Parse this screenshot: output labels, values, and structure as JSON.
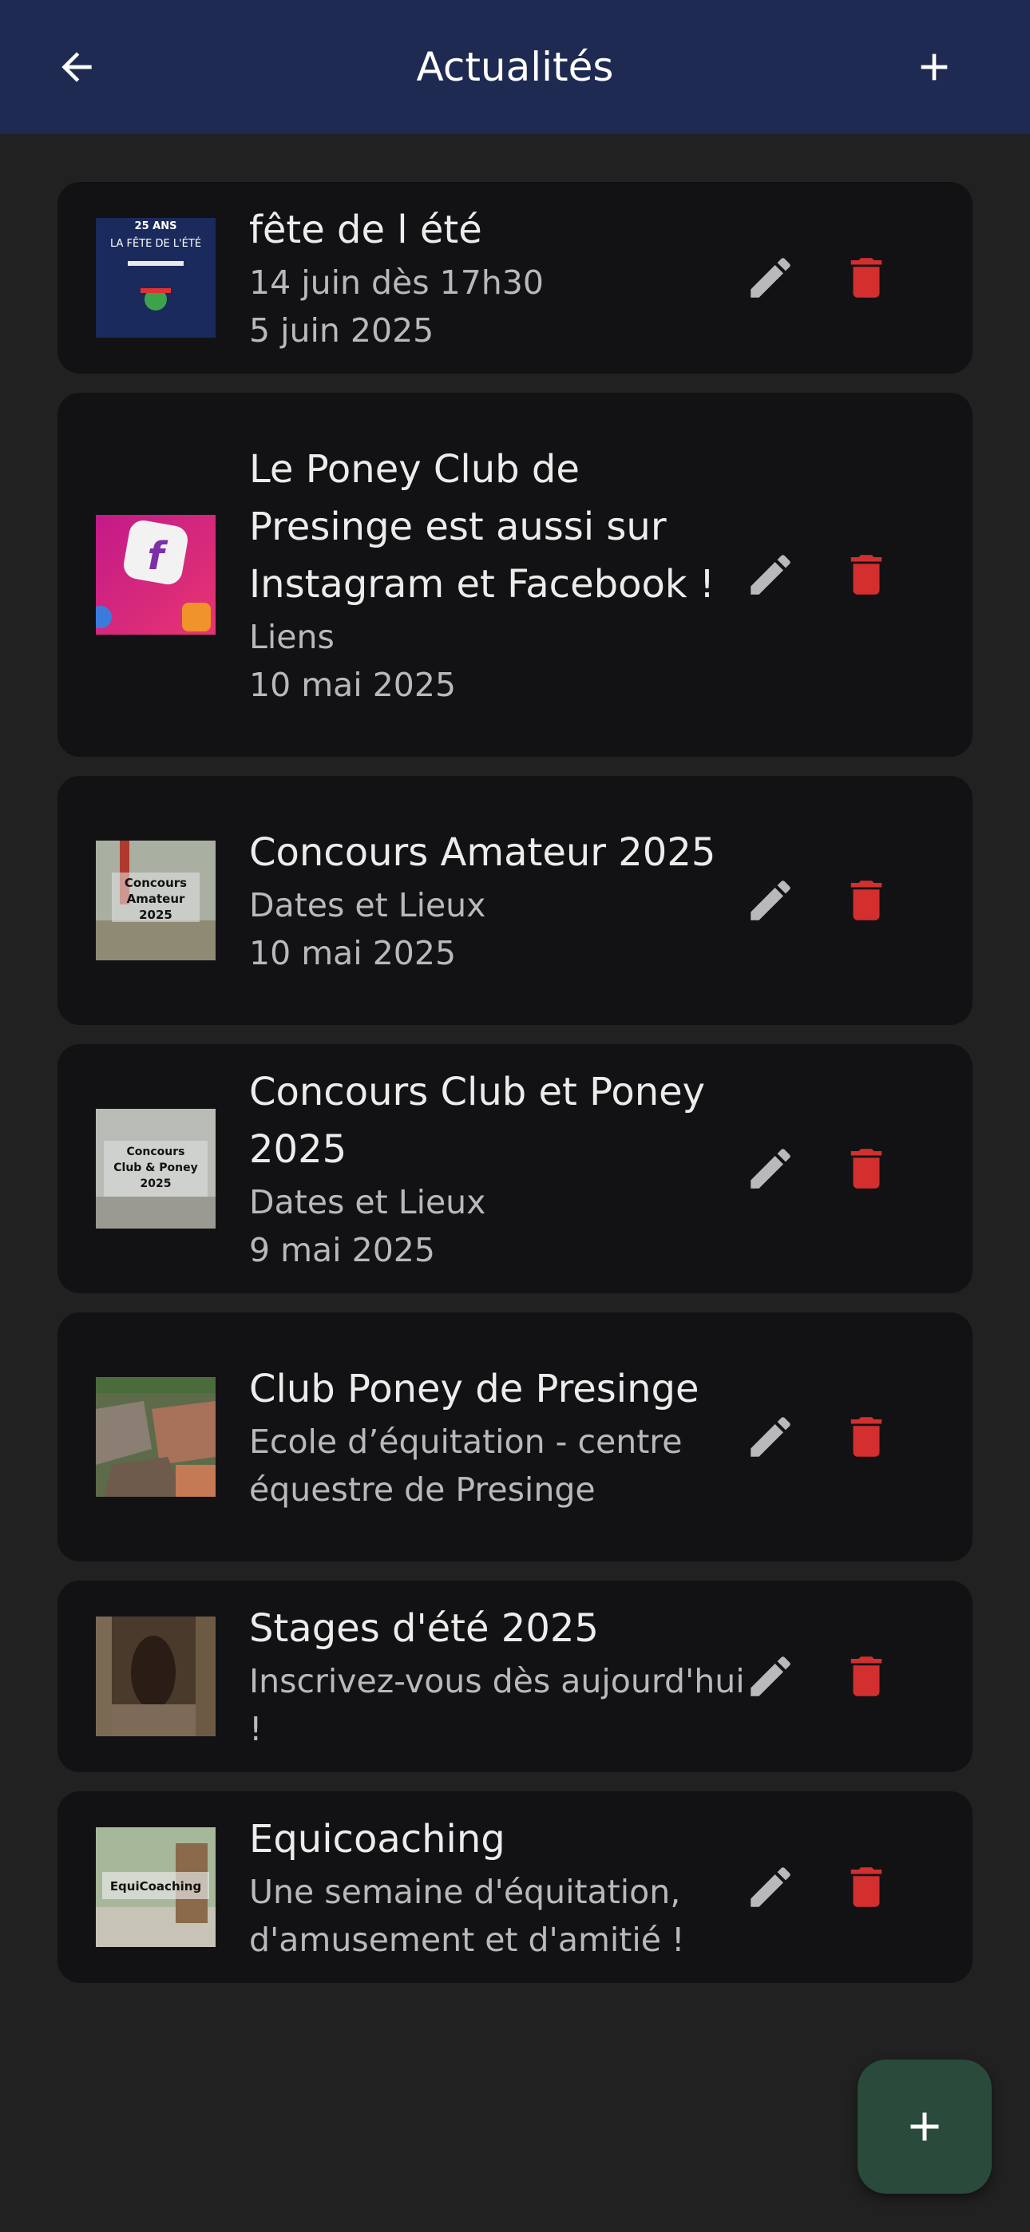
{
  "header": {
    "title": "Actualités",
    "back_icon": "arrow-back-icon",
    "add_icon": "plus-icon"
  },
  "colors": {
    "appbar": "#1e2a52",
    "background": "#212121",
    "card": "#121214",
    "edit": "#b9b9bc",
    "delete": "#d32f2f",
    "fab": "#2a4a3b"
  },
  "items": [
    {
      "title": "fête de l été",
      "lines": [
        "14 juin dès 17h30",
        "5 juin 2025"
      ],
      "thumb_text": [
        "25 ANS",
        "LA FÊTE DE L'ÉTÉ"
      ]
    },
    {
      "title": "Le Poney Club de Presinge est aussi sur Instagram et Facebook !",
      "lines": [
        "Liens",
        "10 mai 2025"
      ],
      "thumb_text": [
        "f"
      ]
    },
    {
      "title": "Concours Amateur 2025",
      "lines": [
        "Dates et Lieux",
        "10 mai 2025"
      ],
      "thumb_text": [
        "Concours",
        "Amateur",
        "2025"
      ]
    },
    {
      "title": "Concours Club et Poney 2025",
      "lines": [
        "Dates et Lieux",
        "9 mai 2025"
      ],
      "thumb_text": [
        "Concours",
        "Club & Poney",
        "2025"
      ]
    },
    {
      "title": "Club Poney de Presinge",
      "lines": [
        "Ecole d’équitation - centre équestre de Presinge"
      ],
      "thumb_text": []
    },
    {
      "title": "Stages d'été 2025",
      "lines": [
        "Inscrivez-vous dès aujourd'hui !"
      ],
      "thumb_text": []
    },
    {
      "title": "Equicoaching",
      "lines": [
        "Une semaine d'équitation, d'amusement et d'amitié !"
      ],
      "thumb_text": [
        "EquiCoaching"
      ]
    }
  ],
  "fab": {
    "icon": "plus-icon"
  }
}
